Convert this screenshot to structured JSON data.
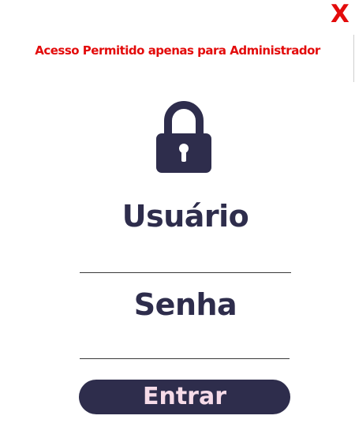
{
  "header": {
    "close_label": "X",
    "warning": "Acesso Permitido apenas para Administrador"
  },
  "icons": {
    "lock": "lock-icon",
    "close": "close-icon"
  },
  "form": {
    "username_label": "Usuário",
    "password_label": "Senha",
    "submit_label": "Entrar"
  },
  "colors": {
    "alert_red": "#e30b0b",
    "primary_navy": "#2e2d4c",
    "button_text_pink": "#f6dbe8",
    "background": "#ffffff"
  }
}
